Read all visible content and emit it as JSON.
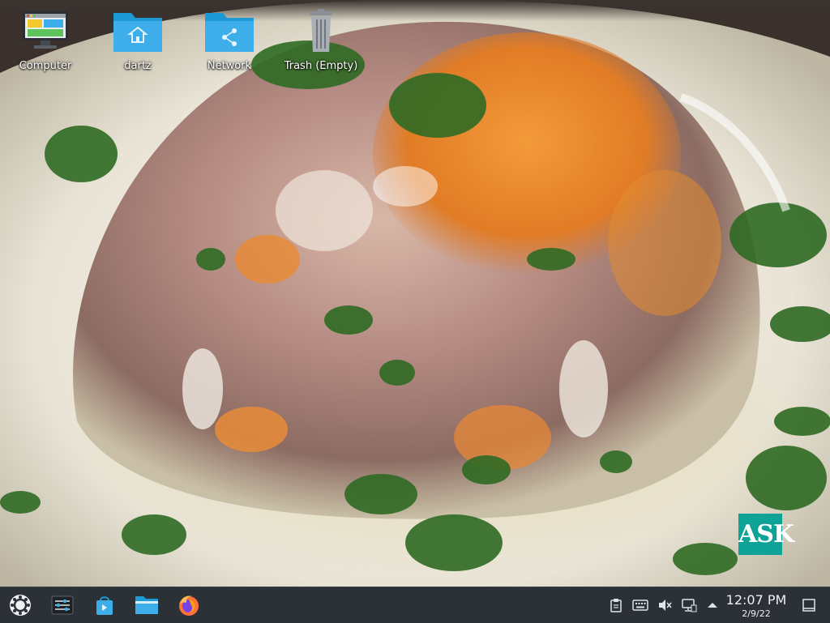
{
  "desktop": {
    "icons": [
      {
        "label": "Computer",
        "icon": "computer-icon"
      },
      {
        "label": "dartz",
        "icon": "home-folder-icon"
      },
      {
        "label": "Network",
        "icon": "network-folder-icon"
      },
      {
        "label": "Trash (Empty)",
        "icon": "trash-icon"
      }
    ],
    "watermark": "ASK"
  },
  "taskbar": {
    "launchers": [
      "app-launcher-icon",
      "system-settings-icon",
      "discover-store-icon",
      "file-manager-icon",
      "firefox-icon"
    ],
    "tray": [
      "clipboard-icon",
      "keyboard-icon",
      "volume-muted-icon",
      "network-icon",
      "show-hidden-icons-arrow"
    ],
    "clock": {
      "time": "12:07 PM",
      "date": "2/9/22"
    }
  },
  "colors": {
    "taskbar": "#2b3136",
    "folder": "#3daee9",
    "accent": "#0fa296"
  }
}
